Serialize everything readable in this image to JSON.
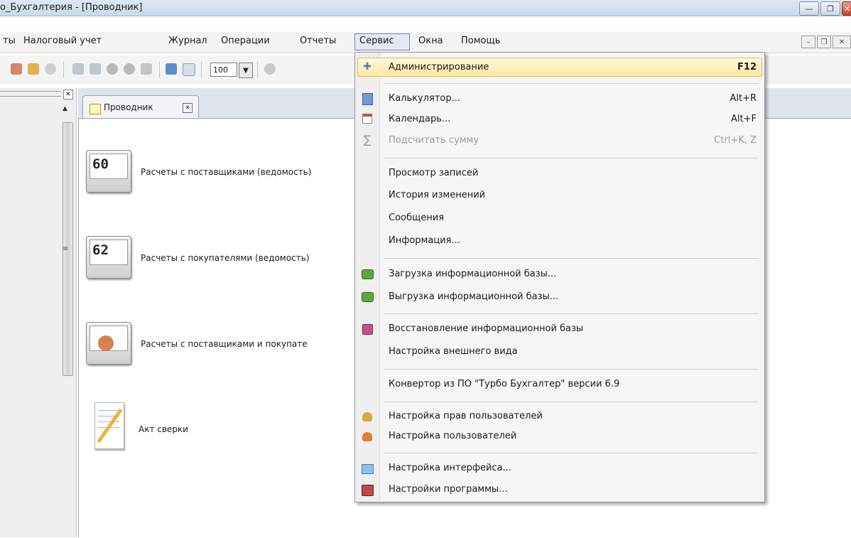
{
  "window": {
    "title": "о_Бухгалтерия - [Проводник]",
    "controls": {
      "minimize": "—",
      "maximize": "❐",
      "close": "✕"
    }
  },
  "menubar": {
    "items": [
      "ты",
      "Налоговый учет",
      "Журнал",
      "Операции",
      "Отчеты",
      "Сервис",
      "Окна",
      "Помощь"
    ],
    "mdi_controls": {
      "minimize": "–",
      "restore": "❐",
      "close": "✕"
    }
  },
  "toolbar": {
    "zoom_value": "100",
    "zoom_arrow": "▼"
  },
  "left_panel": {
    "close": "✕",
    "scroll_up": "▲",
    "grip": "≡"
  },
  "tab": {
    "label": "Проводник",
    "close": "✕"
  },
  "reports": [
    {
      "number": "60",
      "label": "Расчеты с поставщиками (ведомость)"
    },
    {
      "number": "62",
      "label": "Расчеты с покупателями (ведомость)"
    },
    {
      "number": "",
      "label": "Расчеты с поставщиками и покупате"
    },
    {
      "number": "",
      "label": "Акт сверки"
    }
  ],
  "service_menu": {
    "items": [
      {
        "label": "Администрирование",
        "shortcut": "F12",
        "icon": "admin-network-icon"
      },
      {
        "label": "Калькулятор...",
        "shortcut": "Alt+R",
        "icon": "calculator-icon"
      },
      {
        "label": "Календарь...",
        "shortcut": "Alt+F",
        "icon": "calendar-icon"
      },
      {
        "label": "Подсчитать сумму",
        "shortcut": "Ctrl+K, Z",
        "icon": "sigma-icon",
        "disabled": true
      },
      {
        "label": "Просмотр записей",
        "shortcut": ""
      },
      {
        "label": "История изменений",
        "shortcut": ""
      },
      {
        "label": "Сообщения",
        "shortcut": ""
      },
      {
        "label": "Информация...",
        "shortcut": ""
      },
      {
        "label": "Загрузка информационной базы...",
        "shortcut": "",
        "icon": "database-load-icon"
      },
      {
        "label": "Выгрузка информационной базы...",
        "shortcut": "",
        "icon": "database-unload-icon"
      },
      {
        "label": "Восстановление информационной базы",
        "shortcut": "",
        "icon": "restore-icon"
      },
      {
        "label": "Настройка внешнего вида",
        "shortcut": ""
      },
      {
        "label": "Конвертор из ПО \"Турбо Бухгалтер\" версии 6.9",
        "shortcut": ""
      },
      {
        "label": "Настройка прав пользователей",
        "shortcut": "",
        "icon": "user-rights-icon"
      },
      {
        "label": "Настройка пользователей",
        "shortcut": "",
        "icon": "users-icon"
      },
      {
        "label": "Настройка интерфейса...",
        "shortcut": "",
        "icon": "interface-settings-icon"
      },
      {
        "label": "Настройки программы...",
        "shortcut": "",
        "icon": "program-settings-icon"
      }
    ]
  },
  "colors": {
    "highlight": "#ffe8a3",
    "highlight_border": "#e6b84d",
    "title_bar": "#c9d9ec",
    "close_button": "#c7432c"
  }
}
